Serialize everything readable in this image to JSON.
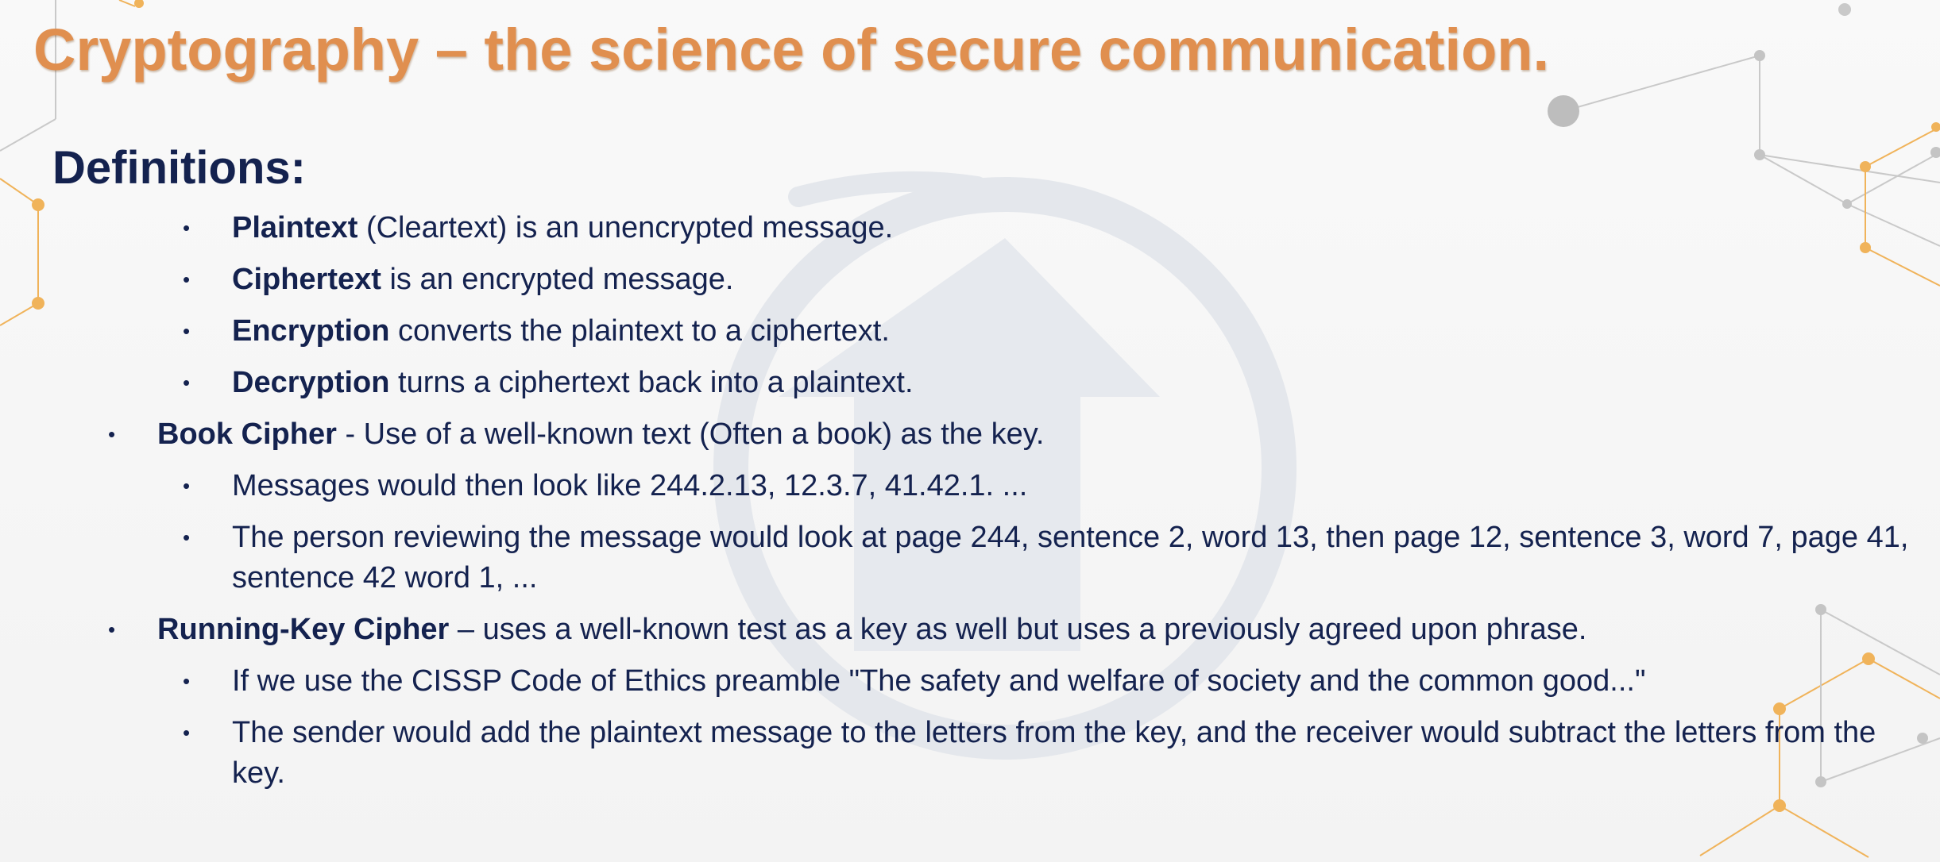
{
  "slide": {
    "title": "Cryptography – the science of secure communication.",
    "heading": "Definitions:",
    "colors": {
      "title": "#e08f4f",
      "text": "#14224f",
      "accent_gold": "#f0b35a",
      "watermark": "#e4e7ec"
    },
    "watermark_icon": "circle-arrow-logo",
    "bullet_glyph": "•",
    "items": [
      {
        "term": "Plaintext",
        "rest": " (Cleartext) is an unencrypted message."
      },
      {
        "term": "Ciphertext",
        "rest": " is an encrypted message."
      },
      {
        "term": "Encryption",
        "rest": " converts the plaintext to a ciphertext."
      },
      {
        "term": "Decryption",
        "rest": " turns a ciphertext back into a plaintext."
      },
      {
        "term": "Book Cipher",
        "rest": " - Use of a well-known text (Often a book) as the key."
      },
      {
        "text": "Messages would then look like 244.2.13, 12.3.7, 41.42.1. ..."
      },
      {
        "text": "The person reviewing the message would look at page 244, sentence 2, word 13, then page 12, sentence 3, word 7, page 41, sentence 42 word 1, ..."
      },
      {
        "term": "Running-Key Cipher",
        "rest": " – uses a well-known test as a key as well but uses a previously agreed upon phrase."
      },
      {
        "text": "If we use the CISSP Code of Ethics preamble \"The safety and welfare of society and the common good...\""
      },
      {
        "text": "The sender would add the plaintext message to the letters from the key, and the receiver would subtract the letters from the key."
      }
    ]
  }
}
